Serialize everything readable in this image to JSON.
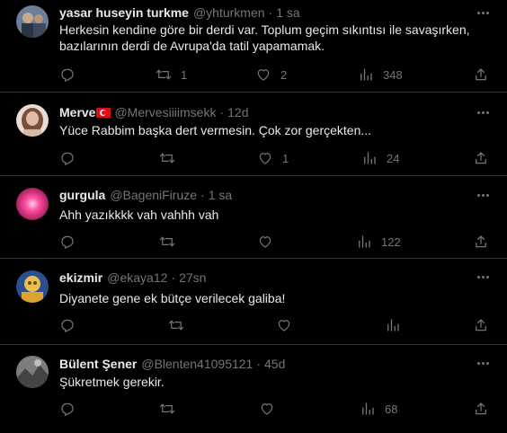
{
  "tweets": [
    {
      "name": "yasar huseyin turkme",
      "handle": "@yhturkmen",
      "time": "1 sa",
      "text": "Herkesin kendine göre bir derdi var. Toplum geçim sıkıntısı ile savaşırken, bazılarının derdi de Avrupa'da tatil yapamamak.",
      "reply": "",
      "retweet": "1",
      "like": "2",
      "views": "348",
      "avatar_colors": [
        "#6b7f99",
        "#2b3442"
      ]
    },
    {
      "name": "Merve",
      "handle": "@Mervesiiiimsekk",
      "time": "12d",
      "text": "Yüce Rabbim başka dert vermesin. Çok zor gerçekten...",
      "reply": "",
      "retweet": "",
      "like": "1",
      "views": "24",
      "avatar_colors": [
        "#d9b8a8",
        "#7a4e3d"
      ]
    },
    {
      "name": "gurgula",
      "handle": "@BageniFiruze",
      "time": "1 sa",
      "text": "Ahh yazıkkkk vah vahhh vah",
      "reply": "",
      "retweet": "",
      "like": "",
      "views": "122",
      "avatar_colors": [
        "#ff4fa0",
        "#8a0f4a"
      ]
    },
    {
      "name": "ekizmir",
      "handle": "@ekaya12",
      "time": "27sn",
      "text": "Diyanete gene ek bütçe verilecek galiba!",
      "reply": "",
      "retweet": "",
      "like": "",
      "views": "",
      "avatar_colors": [
        "#e8c04a",
        "#2a4f8f"
      ]
    },
    {
      "name": "Bülent Şener",
      "handle": "@Blenten41095121",
      "time": "45d",
      "text": "Şükretmek gerekir.",
      "reply": "",
      "retweet": "",
      "like": "",
      "views": "68",
      "avatar_colors": [
        "#9a9a9a",
        "#444444"
      ]
    }
  ],
  "colors": {
    "background": "#000000",
    "text": "#e7e9ea",
    "muted": "#71767b",
    "divider": "#2f3336",
    "flag_red": "#e30a17"
  },
  "icons": [
    "reply-icon",
    "retweet-icon",
    "like-icon",
    "views-icon",
    "share-icon",
    "more-icon",
    "turkish-flag-icon"
  ]
}
